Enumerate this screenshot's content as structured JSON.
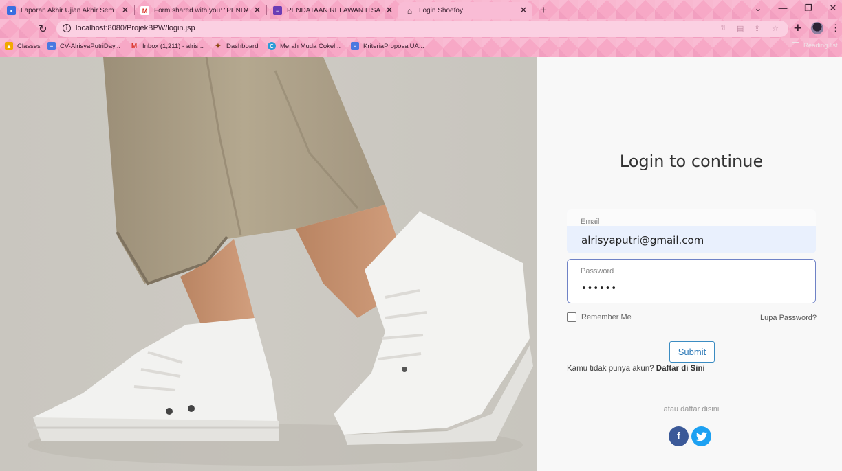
{
  "browser": {
    "tabs": [
      {
        "label": "Laporan Akhir Ujian Akhir Semes",
        "icon": "classroom-icon",
        "color": "#3a6ee0"
      },
      {
        "label": "Form shared with you: \"PENDATA",
        "icon": "gmail-icon",
        "color": "#d93025"
      },
      {
        "label": "PENDATAAN RELAWAN ITSA BER",
        "icon": "forms-icon",
        "color": "#6a3cb5"
      },
      {
        "label": "Login Shoefoy",
        "icon": "home-icon",
        "color": "#3b2030"
      }
    ],
    "new_tab": "+",
    "window_controls": {
      "minimize": "—",
      "restore": "❐",
      "close": "✕",
      "tab_list": "⌄"
    },
    "url": "localhost:8080/ProjekBPW/login.jsp",
    "bookmarks": [
      {
        "label": "Classes",
        "icon": "classes-icon",
        "color": "#f2a900"
      },
      {
        "label": "CV-AlrisyaPutriDay...",
        "icon": "docs-icon",
        "color": "#4a78e0"
      },
      {
        "label": "Inbox (1,211) - alris...",
        "icon": "gmail-icon",
        "color": "#d93025"
      },
      {
        "label": "Dashboard",
        "icon": "dashboard-icon",
        "color": "#b06a20"
      },
      {
        "label": "Merah Muda Cokel...",
        "icon": "canva-icon",
        "color": "#2a9bd6"
      },
      {
        "label": "KriteriaProposalUA...",
        "icon": "docs-icon",
        "color": "#4a78e0"
      }
    ],
    "reading_list": "Reading list"
  },
  "login": {
    "title": "Login to continue",
    "email_label": "Email",
    "email_value": "alrisyaputri@gmail.com",
    "password_label": "Password",
    "password_value": "••••••",
    "remember_label": "Remember Me",
    "forgot_label": "Lupa Password?",
    "submit_label": "Submit",
    "register_prompt": "Kamu tidak punya akun?",
    "register_link": "Daftar di Sini",
    "alt_text": "atau daftar disini",
    "social": {
      "facebook": "f",
      "twitter": "t"
    }
  },
  "colors": {
    "chrome_pink": "#f7a8c6",
    "active_tab": "#f9bcd5",
    "email_fill": "#e9f0fd",
    "password_border": "#6f82c6",
    "submit_border": "#3b8cc2",
    "facebook": "#3b5998",
    "twitter": "#1da1f2"
  }
}
